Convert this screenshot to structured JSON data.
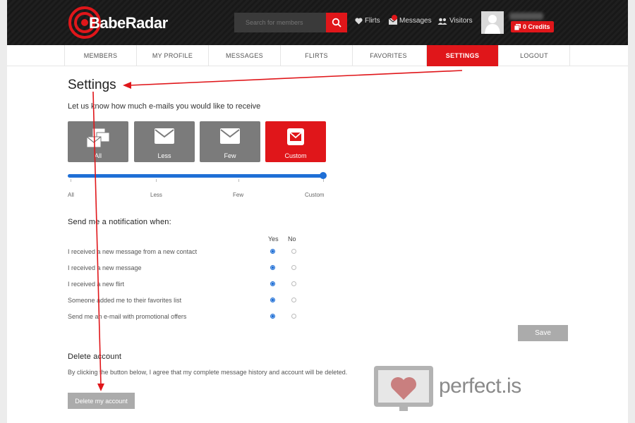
{
  "brand": {
    "name": "BabeRadar",
    "accent": "#e0161a",
    "slider_color": "#1f6fd6"
  },
  "header": {
    "search_placeholder": "Search for members",
    "search_icon": "magnifier-icon",
    "links": {
      "flirts": "Flirts",
      "messages": "Messages",
      "visitors": "Visitors"
    },
    "credits_label": "0 Credits"
  },
  "nav": {
    "tabs": [
      "MEMBERS",
      "MY PROFILE",
      "MESSAGES",
      "FLIRTS",
      "FAVORITES",
      "SETTINGS",
      "LOGOUT"
    ],
    "active": "SETTINGS"
  },
  "settings": {
    "title": "Settings",
    "email_prompt": "Let us know how much e-mails you would like to receive",
    "frequency_options": [
      "All",
      "Less",
      "Few",
      "Custom"
    ],
    "frequency_selected": "Custom",
    "scale_labels": [
      "All",
      "Less",
      "Few",
      "Custom"
    ],
    "slider_value": 1.0,
    "notifications": {
      "heading": "Send me a notification when:",
      "col_yes": "Yes",
      "col_no": "No",
      "items": [
        {
          "label": "I received a new message from a new contact",
          "value": "yes"
        },
        {
          "label": "I received a new message",
          "value": "yes"
        },
        {
          "label": "I received a new flirt",
          "value": "yes"
        },
        {
          "label": "Someone added me to their favorites list",
          "value": "yes"
        },
        {
          "label": "Send me an e-mail with promotional offers",
          "value": "yes"
        }
      ]
    },
    "save_label": "Save",
    "delete": {
      "heading": "Delete account",
      "description": "By clicking the button below, I agree that my complete message history and account will be deleted.",
      "button_label": "Delete my account"
    }
  },
  "watermark": {
    "text": "perfect.is"
  }
}
